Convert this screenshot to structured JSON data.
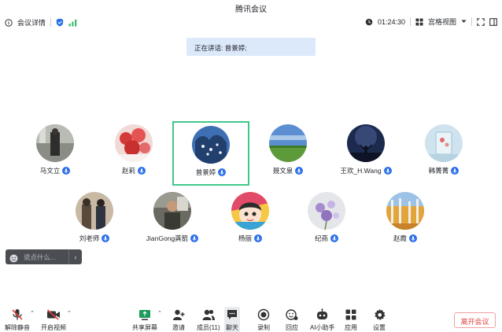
{
  "window": {
    "title": "腾讯会议"
  },
  "topbar": {
    "meeting_info": "会议详情",
    "timer": "01:24:30",
    "view_mode": "宫格视图"
  },
  "speaking": {
    "text": "正在讲话: 曾景婷;"
  },
  "participants": [
    {
      "name": "马文立"
    },
    {
      "name": "赵莉"
    },
    {
      "name": "曾景婷"
    },
    {
      "name": "聂文泉"
    },
    {
      "name": "王欢_H.Wang"
    },
    {
      "name": "韩菁菁"
    },
    {
      "name": "刘老师"
    },
    {
      "name": "JianGong龚箭"
    },
    {
      "name": "杨丽"
    },
    {
      "name": "纪燕"
    },
    {
      "name": "赵霞"
    }
  ],
  "chat": {
    "placeholder": "说点什么..."
  },
  "bottombar": {
    "unmute": "解除静音",
    "start_video": "开启视频",
    "share_screen": "共享屏幕",
    "invite": "邀请",
    "members": "成员(11)",
    "chat": "聊天",
    "record": "录制",
    "replay": "回应",
    "ai_assistant": "AI小助手",
    "apps": "应用",
    "settings": "设置",
    "leave": "离开会议"
  },
  "colors": {
    "accent": "#2a6fe8",
    "active_border": "#41c889",
    "leave_red": "#e2423c",
    "speaking_bg": "#dce9fb"
  }
}
